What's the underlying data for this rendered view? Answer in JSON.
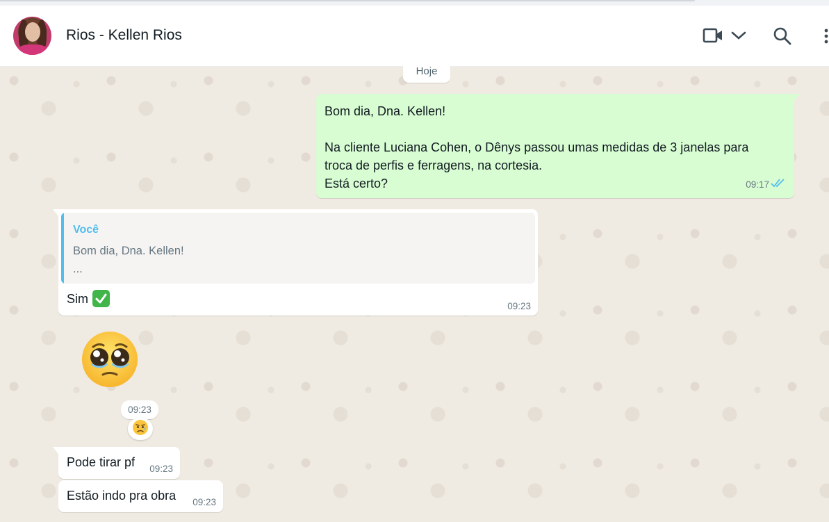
{
  "header": {
    "contact_name": "Rios - Kellen Rios",
    "icons": [
      "video-call-icon",
      "chevron-down-icon",
      "search-icon",
      "menu-icon"
    ]
  },
  "chat": {
    "date_divider": "Hoje",
    "outgoing_message": {
      "lines": [
        "Bom dia, Dna. Kellen!",
        "",
        "Na cliente Luciana Cohen, o Dênys passou umas medidas de 3 janelas para",
        "troca de perfis e ferragens, na cortesia.",
        "Está certo?"
      ],
      "time": "09:17",
      "status": "read"
    },
    "reply_message": {
      "quoted_author": "Você",
      "quoted_line1": "Bom dia, Dna. Kellen!",
      "quoted_line2": "...",
      "text": "Sim",
      "emoji": "check-mark-button-emoji",
      "time": "09:23"
    },
    "emoji_message": {
      "emoji": "pleading-face-emoji",
      "time": "09:23",
      "reaction": "sad-but-relieved-face-emoji"
    },
    "messages": [
      {
        "text": "Pode tirar pf",
        "time": "09:23"
      },
      {
        "text": "Estão indo pra obra",
        "time": "09:23"
      }
    ]
  },
  "colors": {
    "outgoing_bubble": "#d9fdd3",
    "incoming_bubble": "#ffffff",
    "chat_background": "#efeae2",
    "quote_author": "#53bdeb",
    "read_ticks": "#53bdeb"
  }
}
